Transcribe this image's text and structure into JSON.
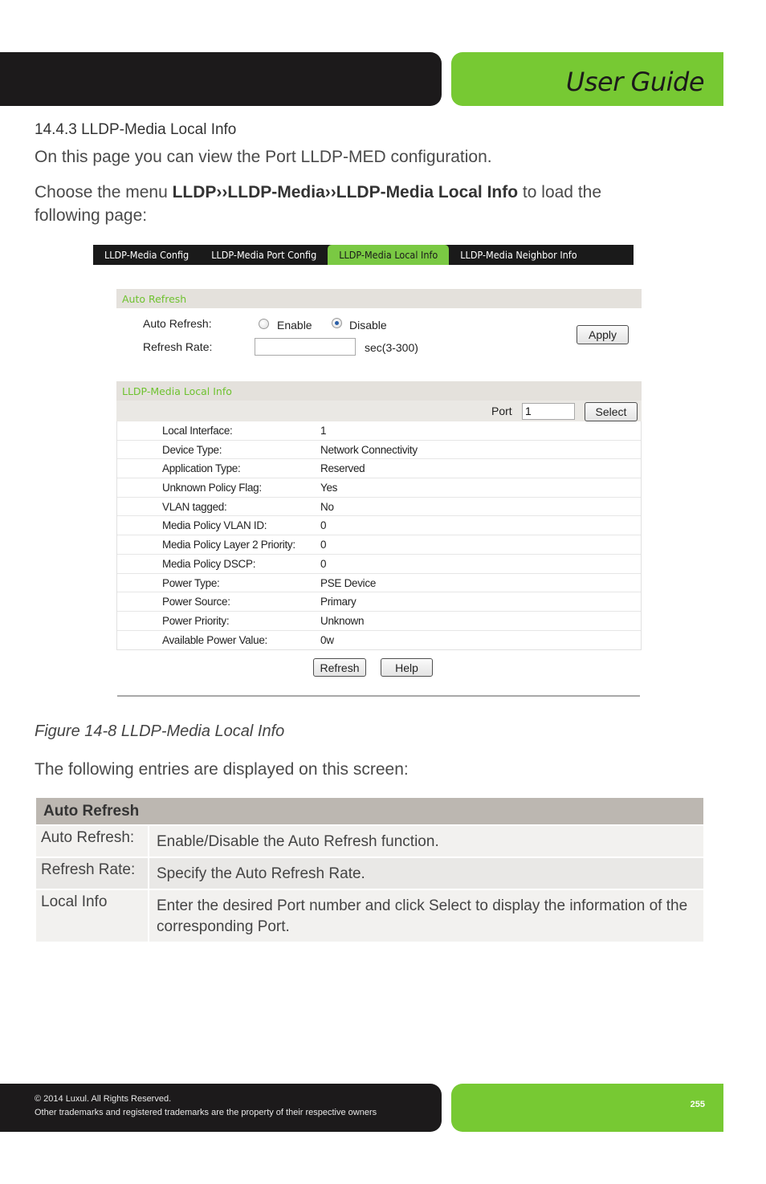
{
  "header": {
    "title": "User Guide",
    "brand_color": "#77c933",
    "dark_color": "#1c1a1b"
  },
  "section": {
    "title": "14.4.3 LLDP-Media Local Info",
    "intro": "On this page you can view the Port LLDP-MED configuration.",
    "menu_prefix": "Choose the menu ",
    "menu_path": "LLDP››LLDP-Media››LLDP-Media Local Info",
    "menu_suffix": " to load the following page:"
  },
  "screenshot": {
    "tabs": [
      {
        "label": "LLDP-Media Config",
        "active": false
      },
      {
        "label": "LLDP-Media Port Config",
        "active": false
      },
      {
        "label": "LLDP-Media Local Info",
        "active": true
      },
      {
        "label": "LLDP-Media Neighbor Info",
        "active": false
      }
    ],
    "auto_refresh_panel": {
      "title": "Auto Refresh",
      "auto_refresh_label": "Auto Refresh:",
      "options": [
        {
          "label": "Enable",
          "selected": false
        },
        {
          "label": "Disable",
          "selected": true
        }
      ],
      "refresh_rate_label": "Refresh Rate:",
      "refresh_rate_value": "",
      "refresh_rate_hint": "sec(3-300)",
      "apply_button": "Apply"
    },
    "local_info_panel": {
      "title": "LLDP-Media Local Info",
      "port_label": "Port",
      "port_value": "1",
      "select_button": "Select",
      "rows": [
        {
          "key": "Local Interface:",
          "value": "1"
        },
        {
          "key": "Device Type:",
          "value": "Network Connectivity"
        },
        {
          "key": "Application Type:",
          "value": "Reserved"
        },
        {
          "key": "Unknown Policy Flag:",
          "value": "Yes"
        },
        {
          "key": "VLAN tagged:",
          "value": "No"
        },
        {
          "key": "Media Policy VLAN ID:",
          "value": "0"
        },
        {
          "key": "Media Policy Layer 2 Priority:",
          "value": "0"
        },
        {
          "key": "Media Policy DSCP:",
          "value": "0"
        },
        {
          "key": "Power Type:",
          "value": "PSE Device"
        },
        {
          "key": "Power Source:",
          "value": "Primary"
        },
        {
          "key": "Power Priority:",
          "value": "Unknown"
        },
        {
          "key": "Available Power Value:",
          "value": "0w"
        }
      ],
      "refresh_button": "Refresh",
      "help_button": "Help"
    }
  },
  "caption": "Figure 14-8 LLDP-Media Local Info",
  "entries_intro": "The following entries are displayed on this screen:",
  "description_table": {
    "header": "Auto Refresh",
    "rows": [
      {
        "field": "Auto Refresh:",
        "description": "Enable/Disable the Auto Refresh function."
      },
      {
        "field": "Refresh Rate:",
        "description": "Specify the Auto Refresh Rate."
      },
      {
        "field": "Local Info",
        "description": "Enter the desired Port number and click Select to display the information of the corresponding Port."
      }
    ]
  },
  "footer": {
    "copyright": "© 2014  Luxul. All Rights Reserved.",
    "trademarks": "Other trademarks and registered trademarks are the property of their respective owners",
    "page_number": "255"
  }
}
